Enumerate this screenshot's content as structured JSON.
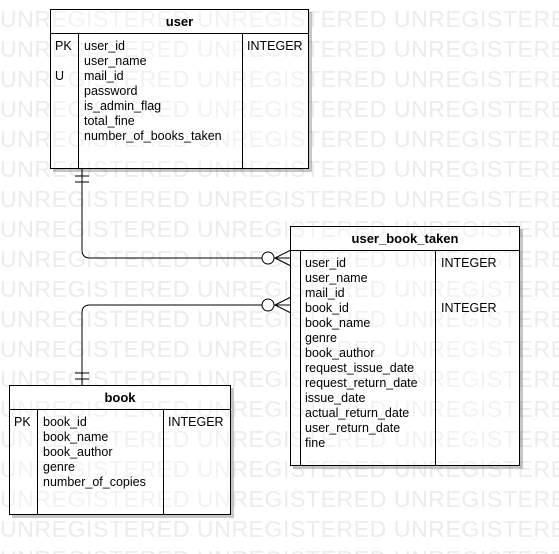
{
  "watermark": {
    "text": "UNREGISTERED UNREGISTERED UNREGISTERED"
  },
  "entities": {
    "user": {
      "title": "user",
      "keys": [
        "PK",
        "",
        "U",
        "",
        "",
        "",
        ""
      ],
      "fields": [
        "user_id",
        "user_name",
        "mail_id",
        "password",
        "is_admin_flag",
        "total_fine",
        "number_of_books_taken"
      ],
      "types": [
        "INTEGER",
        "",
        "",
        "",
        "",
        "",
        ""
      ]
    },
    "user_book_taken": {
      "title": "user_book_taken",
      "fields": [
        "user_id",
        "user_name",
        "mail_id",
        "book_id",
        "book_name",
        "genre",
        "book_author",
        "request_issue_date",
        "request_return_date",
        "issue_date",
        "actual_return_date",
        "user_return_date",
        "fine"
      ],
      "types": [
        "INTEGER",
        "",
        "",
        "INTEGER",
        "",
        "",
        "",
        "",
        "",
        "",
        "",
        "",
        ""
      ]
    },
    "book": {
      "title": "book",
      "keys": [
        "PK",
        "",
        "",
        "",
        ""
      ],
      "fields": [
        "book_id",
        "book_name",
        "book_author",
        "genre",
        "number_of_copies"
      ],
      "types": [
        "INTEGER",
        "",
        "",
        "",
        ""
      ]
    }
  },
  "relationships": [
    {
      "from": "user",
      "to": "user_book_taken",
      "from_cardinality": "one-and-only-one",
      "to_cardinality": "zero-or-many"
    },
    {
      "from": "book",
      "to": "user_book_taken",
      "from_cardinality": "one-and-only-one",
      "to_cardinality": "zero-or-many"
    }
  ]
}
